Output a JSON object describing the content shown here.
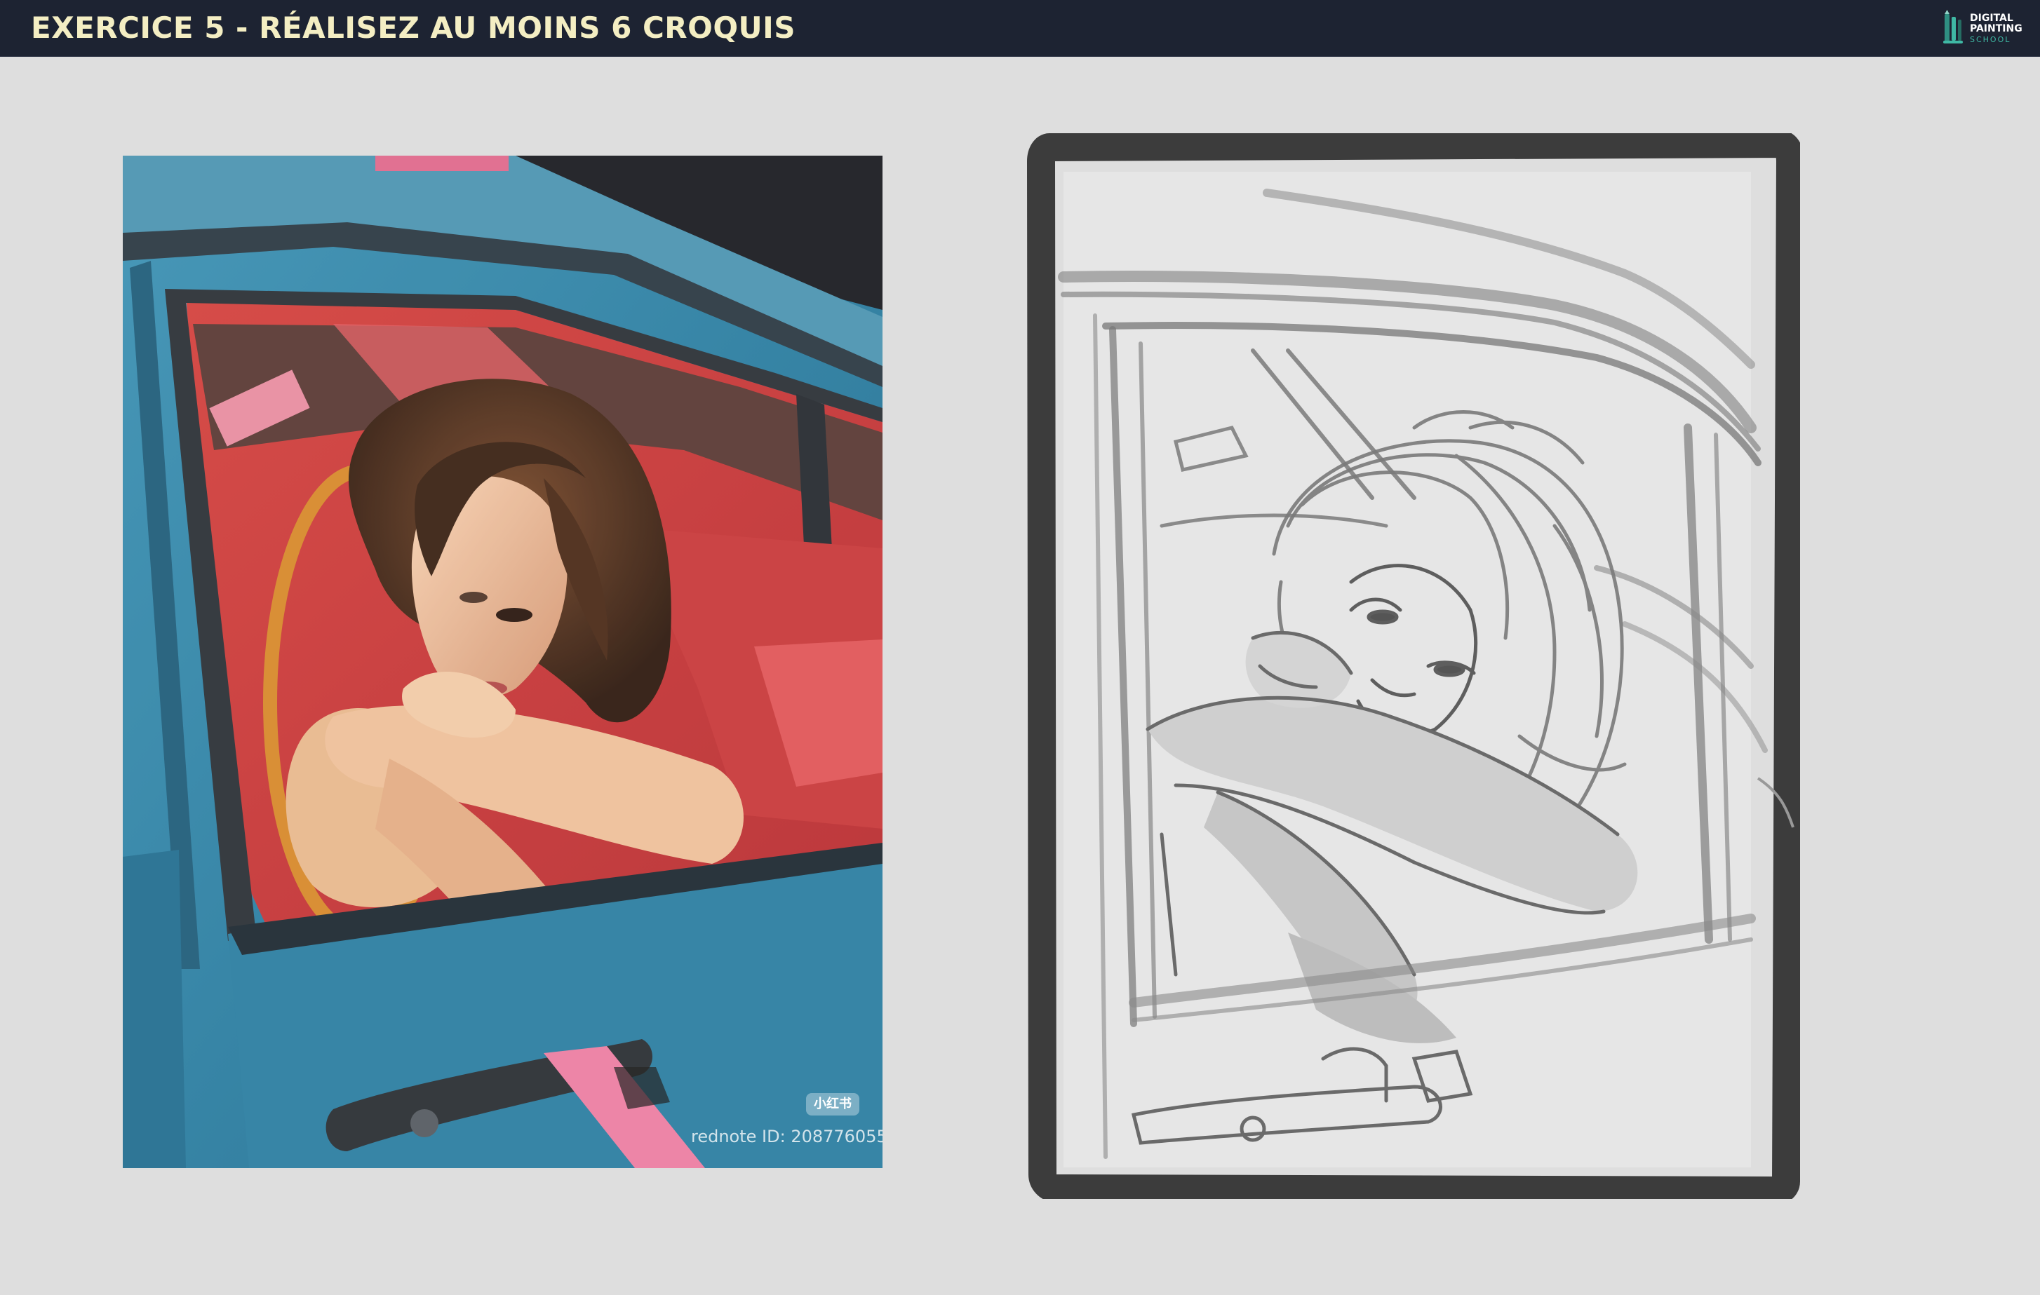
{
  "header": {
    "title": "EXERCICE 5 - RÉALISEZ AU MOINS 6 CROQUIS",
    "logo": {
      "line1": "DIGITAL",
      "line2": "PAINTING",
      "line3": "SCHOOL",
      "icon": "paint-brush-pencil-icon"
    }
  },
  "reference_photo": {
    "watermark_badge": "小红书",
    "watermark_text": "rednote ID: 208776055"
  },
  "colors": {
    "header_bg": "#1d2332",
    "title_color": "#f4eec3",
    "page_bg": "#dedede",
    "logo_accent": "#3fb8a4"
  }
}
